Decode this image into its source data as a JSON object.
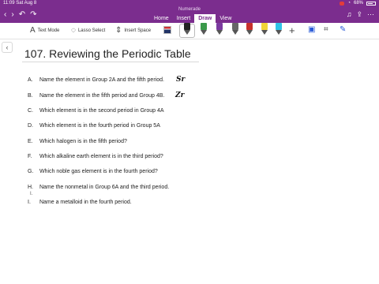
{
  "status_bar": {
    "time_date": "11:09  Sat Aug 8",
    "battery": "68%"
  },
  "app": {
    "title": "Numerade"
  },
  "tabs": [
    {
      "label": "Home"
    },
    {
      "label": "Insert"
    },
    {
      "label": "Draw"
    },
    {
      "label": "View"
    }
  ],
  "toolbar": {
    "text_mode": "Text Mode",
    "lasso_select": "Lasso Select",
    "insert_space": "Insert Space"
  },
  "page": {
    "title": "107. Reviewing the Periodic Table",
    "questions": [
      {
        "letter": "A.",
        "text": "Name the element in Group 2A and the fifth period.",
        "answer": "Sr"
      },
      {
        "letter": "B.",
        "text": "Name the element in the fifth period and Group 4B.",
        "answer": "Zr"
      },
      {
        "letter": "C.",
        "text": "Which element is in the second period in Group 4A",
        "answer": ""
      },
      {
        "letter": "D.",
        "text": "Which element is in the fourth period in Group 5A",
        "answer": ""
      },
      {
        "letter": "E.",
        "text": "Which halogen is in the fifth period?",
        "answer": ""
      },
      {
        "letter": "F.",
        "text": "Which alkaline earth element is in the third period?",
        "answer": ""
      },
      {
        "letter": "G.",
        "text": "Which noble gas element is in the fourth period?",
        "answer": ""
      },
      {
        "letter": "H.",
        "text": "Name the nonmetal in Group 6A and the third period.",
        "answer": ""
      },
      {
        "letter": "I.",
        "text": "Name a metalloid in the fourth period.",
        "answer": ""
      }
    ],
    "stray_mark": "I."
  },
  "colors": {
    "accent": "#7b2d8e"
  }
}
